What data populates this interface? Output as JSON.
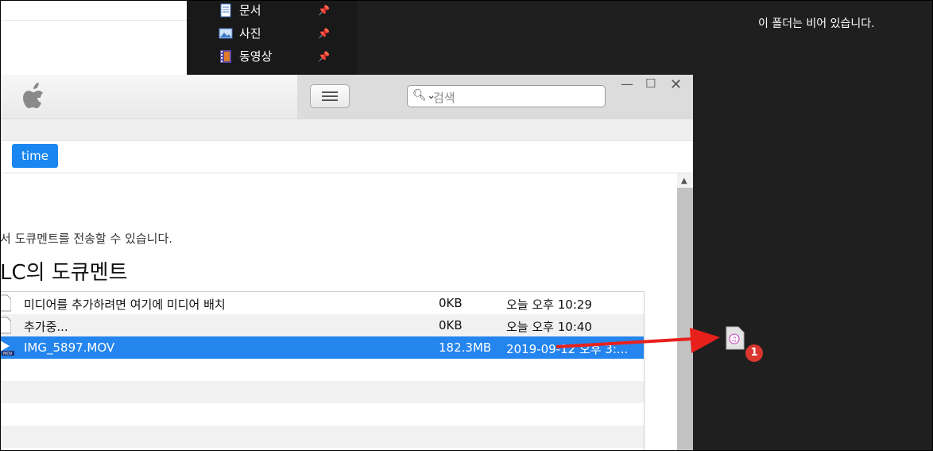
{
  "explorer": {
    "nav_items": [
      {
        "label": "문서",
        "icon": "document-icon"
      },
      {
        "label": "사진",
        "icon": "photo-icon"
      },
      {
        "label": "동영상",
        "icon": "video-icon"
      }
    ],
    "empty_message": "이 폴더는 비어 있습니다."
  },
  "itunes": {
    "search_placeholder": "검색",
    "time_tab": "time",
    "description": "서 도큐멘트를 전송할 수 있습니다.",
    "heading": "LC의 도큐멘트",
    "files": [
      {
        "name": "미디어를 추가하려면 여기에 미디어 배치",
        "size": "0KB",
        "date": "오늘 오후 10:29"
      },
      {
        "name": "추가중...",
        "size": "0KB",
        "date": "오늘 오후 10:40"
      },
      {
        "name": "IMG_5897.MOV",
        "size": "182.3MB",
        "date": "2019-09-12 오후 3:..."
      }
    ]
  },
  "drag_badge": "1",
  "colors": {
    "selected_row": "#2585ee",
    "time_tab": "#1a86f0",
    "arrow": "#e8201c",
    "badge": "#d9362f"
  }
}
